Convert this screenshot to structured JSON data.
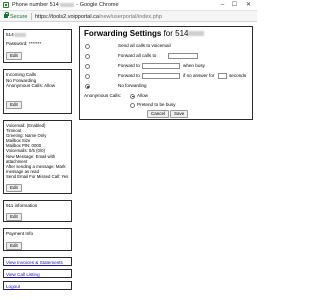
{
  "window": {
    "title_prefix": "Phone number 514",
    "title_suffix": "- Google Chrome",
    "minimize": "–",
    "maximize": "☐",
    "close": "✕"
  },
  "address_bar": {
    "secure_label": "Secure",
    "url_host": "https://tools2.voipportal.ca",
    "url_path": "/new/userportal/index.php"
  },
  "left_column": {
    "account_panel": {
      "number": "514",
      "password_label": "Password:",
      "password_value": "*******",
      "edit_label": "Edit"
    },
    "incoming_calls_panel": {
      "lines": "Incoming Calls\nNo Forwarding\nAnonymous Calls: Allow",
      "edit_label": "Edit"
    },
    "voicemail_panel": {
      "lines": "Voicemail: (Enabled)\nTimeout\nGreeting: Name Only\nMailbox Size\nMailbox PIN: 0000\nVoicemails: 0/5 (0/0)\nNew Message: Email with\nattachment\nAfter sending a message: Mark\nmessage as read\nSend Email For Missed Call: Yes",
      "edit_label": "Edit"
    },
    "info_911_panel": {
      "title": "911 information",
      "edit_label": "Edit"
    },
    "payment_panel": {
      "title": "Payment Info",
      "edit_label": "Edit"
    },
    "links": {
      "invoices": "View Invoices & Statements",
      "call_listing": "View Call Listing",
      "logout": "Logout"
    }
  },
  "forwarding": {
    "title": "Forwarding Settings",
    "title_for": "for 514",
    "option_send_all": "Send all calls to voicemail",
    "option_forward_all": "Forward all calls to",
    "option_forward_busy_prefix": "Forward to",
    "option_forward_busy_suffix": "when busy",
    "option_forward_noanswer_prefix": "Forward to",
    "option_forward_noanswer_mid": "if no answer for",
    "option_forward_noanswer_suffix": "seconds",
    "option_no_forwarding": "No forwarding",
    "anonymous_label": "Anonymous Calls:",
    "anonymous_allow": "Allow",
    "anonymous_pretend_busy": "Pretend to be busy",
    "cancel_label": "Cancel",
    "save_label": "Save"
  }
}
